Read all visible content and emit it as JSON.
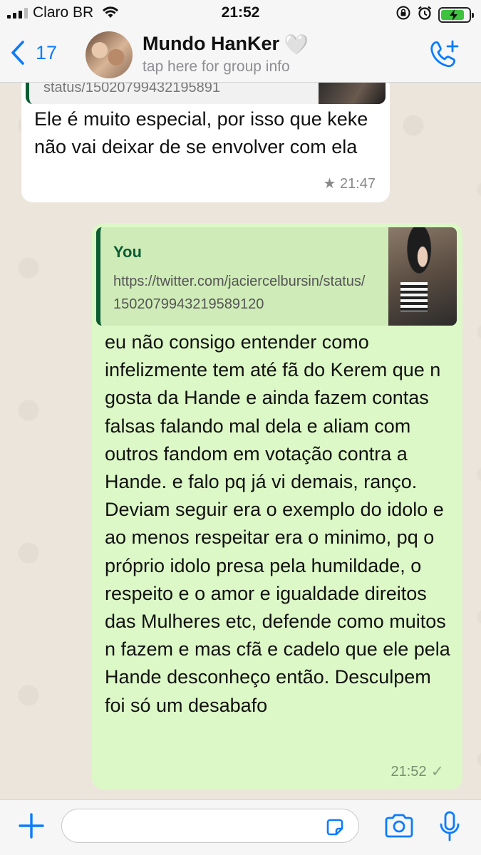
{
  "status_bar": {
    "carrier": "Claro BR",
    "time": "21:52",
    "battery_level": 0.85
  },
  "header": {
    "back_count": "17",
    "group_name": "Mundo HanKer",
    "group_emoji": "🤍",
    "subtitle": "tap here for group info"
  },
  "messages": {
    "incoming": {
      "quoted_text": "status/15020799432195891",
      "text": "Ele é muito especial, por isso que keke não vai deixar de se envolver com ela",
      "time": "21:47",
      "starred": true
    },
    "outgoing": {
      "quote_author": "You",
      "quote_text": "https://twitter.com/jaciercelbursin/status/1502079943219589120",
      "text": "eu não consigo entender como infelizmente tem até fã do Kerem que n gosta da Hande e ainda fazem contas falsas falando mal dela e aliam com outros fandom em votação contra a Hande. e falo pq já vi demais, ranço. Deviam seguir era o exemplo do idolo e ao menos respeitar era o minimo, pq o próprio idolo presa pela humildade, o respeito e o amor e igualdade direitos das Mulheres etc, defende como muitos n fazem e mas cfã e cadelo que ele pela Hande desconheço então. Desculpem foi só um desabafo",
      "time": "21:52"
    }
  },
  "colors": {
    "accent": "#0a7bff",
    "outgoing_bubble": "#dcf8c6",
    "incoming_bubble": "#ffffff",
    "quote_bar": "#0b5c32"
  }
}
